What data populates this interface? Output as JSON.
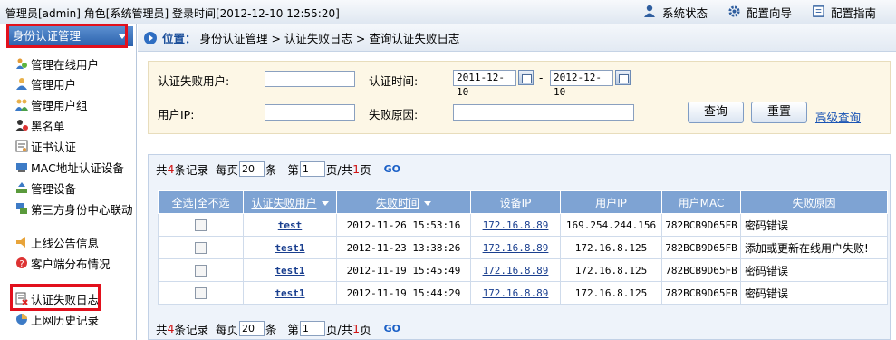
{
  "topbar": {
    "user_info": "管理员[admin] 角色[系统管理员] 登录时间[2012-12-10 12:55:20]",
    "links": [
      {
        "label": "系统状态",
        "icon": "user-status-icon"
      },
      {
        "label": "配置向导",
        "icon": "gear-icon"
      },
      {
        "label": "配置指南",
        "icon": "guide-book-icon"
      }
    ]
  },
  "sidebar": {
    "header": "身份认证管理",
    "items": [
      {
        "label": "管理在线用户",
        "icon": "online-users-icon"
      },
      {
        "label": "管理用户",
        "icon": "user-icon"
      },
      {
        "label": "管理用户组",
        "icon": "user-group-icon"
      },
      {
        "label": "黑名单",
        "icon": "blacklist-icon"
      },
      {
        "label": "证书认证",
        "icon": "certificate-icon"
      },
      {
        "label": "MAC地址认证设备",
        "icon": "mac-device-icon"
      },
      {
        "label": "管理设备",
        "icon": "device-icon"
      },
      {
        "label": "第三方身份中心联动",
        "icon": "third-party-icon"
      },
      {
        "label": "上线公告信息",
        "icon": "announcement-icon"
      },
      {
        "label": "客户端分布情况",
        "icon": "client-distribution-icon"
      },
      {
        "label": "认证失败日志",
        "icon": "auth-fail-log-icon"
      },
      {
        "label": "上网历史记录",
        "icon": "history-icon"
      }
    ]
  },
  "breadcrumb": {
    "prefix": "位置：",
    "path": "身份认证管理 > 认证失败日志 > 查询认证失败日志"
  },
  "search": {
    "user_label": "认证失败用户:",
    "user_value": "",
    "time_label": "认证时间:",
    "date_from": "2011-12-10",
    "date_to": "2012-12-10",
    "dash": "-",
    "ip_label": "用户IP:",
    "ip_value": "",
    "reason_label": "失败原因:",
    "reason_value": "",
    "query_button": "查询",
    "reset_button": "重置",
    "advanced_link": "高级查询"
  },
  "pager": {
    "total_prefix": "共",
    "total": "4",
    "total_suffix": "条记录",
    "per_page_prefix": "每页",
    "per_page": "20",
    "per_page_suffix": "条",
    "page_prefix": "第",
    "page": "1",
    "page_mid": "页/共",
    "page_count": "1",
    "page_suffix": "页",
    "go": "GO"
  },
  "table": {
    "select_all": "全选|全不选",
    "columns": [
      "认证失败用户",
      "失败时间",
      "设备IP",
      "用户IP",
      "用户MAC",
      "失败原因"
    ],
    "rows": [
      {
        "user": "test",
        "time": "2012-11-26 15:53:16",
        "device_ip": "172.16.8.89",
        "user_ip": "169.254.244.156",
        "mac": "782BCB9D65FB",
        "reason": "密码错误"
      },
      {
        "user": "test1",
        "time": "2012-11-23 13:38:26",
        "device_ip": "172.16.8.89",
        "user_ip": "172.16.8.125",
        "mac": "782BCB9D65FB",
        "reason": "添加或更新在线用户失败!"
      },
      {
        "user": "test1",
        "time": "2012-11-19 15:45:49",
        "device_ip": "172.16.8.89",
        "user_ip": "172.16.8.125",
        "mac": "782BCB9D65FB",
        "reason": "密码错误"
      },
      {
        "user": "test1",
        "time": "2012-11-19 15:44:29",
        "device_ip": "172.16.8.89",
        "user_ip": "172.16.8.125",
        "mac": "782BCB9D65FB",
        "reason": "密码错误"
      }
    ]
  },
  "colors": {
    "highlight": "#e2101c",
    "header_blue": "#2c62ad",
    "table_header": "#7ea3d3",
    "search_bg": "#fdf7e6"
  }
}
